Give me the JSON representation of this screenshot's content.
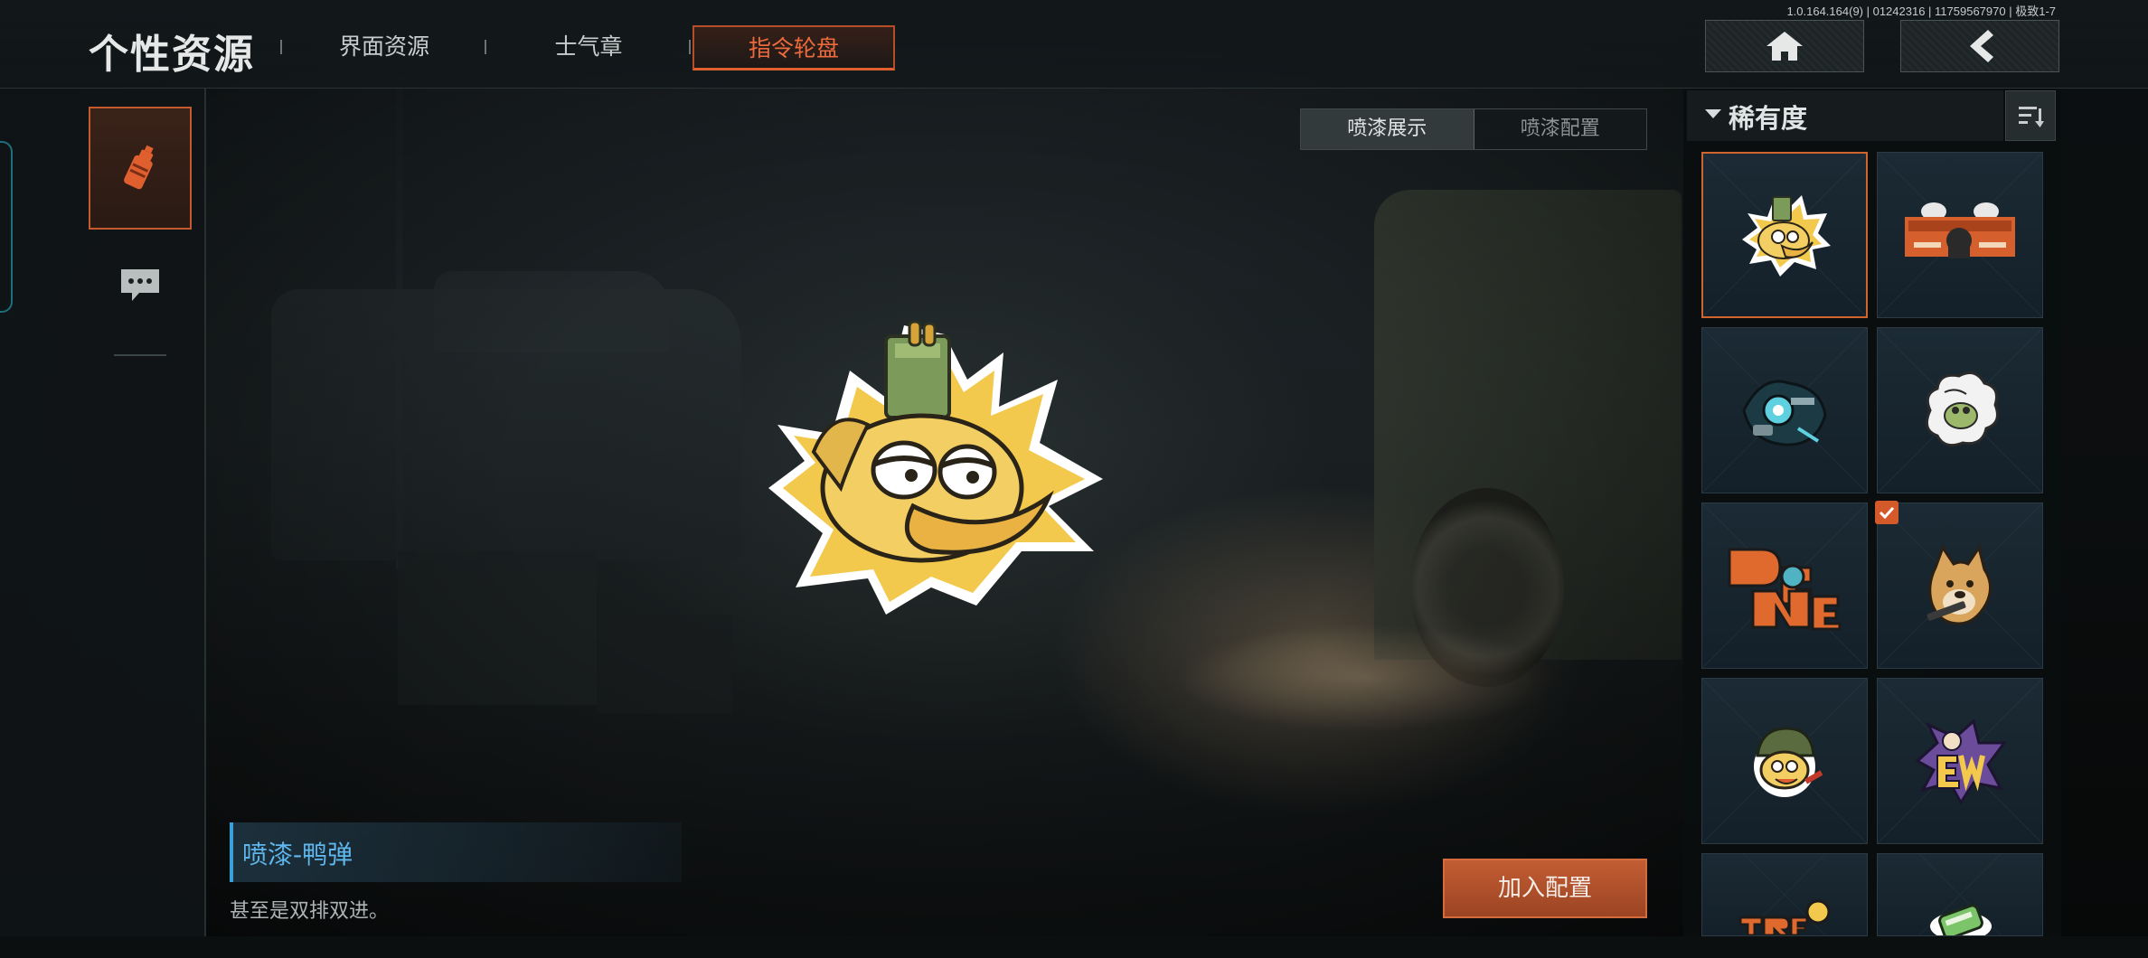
{
  "version": "1.0.164.164(9) | 01242316 | 11759567970 | 极致1-7",
  "header": {
    "title": "个性资源",
    "tabs": [
      {
        "label": "界面资源"
      },
      {
        "label": "士气章"
      },
      {
        "label": "指令轮盘"
      }
    ],
    "home_icon": "home-icon",
    "back_icon": "back-chevron-icon"
  },
  "left_rail": {
    "items": [
      {
        "icon": "spray-can-icon",
        "active": true
      },
      {
        "icon": "chat-bubble-icon",
        "active": false
      }
    ]
  },
  "sub_tabs": [
    {
      "label": "喷漆展示"
    },
    {
      "label": "喷漆配置"
    }
  ],
  "selected_item": {
    "name": "喷漆-鸭弹",
    "description": "甚至是双排双进。"
  },
  "add_button_label": "加入配置",
  "right_panel": {
    "sort_title": "稀有度",
    "items": [
      {
        "icon": "duck-ammo-spray-icon",
        "selected": true,
        "checked": false
      },
      {
        "icon": "soldier-banner-spray-icon",
        "selected": false,
        "checked": false
      },
      {
        "icon": "blue-robot-spray-icon",
        "selected": false,
        "checked": false
      },
      {
        "icon": "cloud-frog-spray-icon",
        "selected": false,
        "checked": false
      },
      {
        "icon": "dream-graffiti-spray-icon",
        "selected": false,
        "checked": false
      },
      {
        "icon": "doge-spray-icon",
        "selected": false,
        "checked": true
      },
      {
        "icon": "helmet-duck-spray-icon",
        "selected": false,
        "checked": false
      },
      {
        "icon": "ewa-graffiti-spray-icon",
        "selected": false,
        "checked": false
      },
      {
        "icon": "tree-graffiti-spray-icon",
        "selected": false,
        "checked": false
      },
      {
        "icon": "green-can-spray-icon",
        "selected": false,
        "checked": false
      }
    ]
  },
  "colors": {
    "accent": "#e05f2f",
    "info_blue": "#5fb6ec",
    "panel_bg": "#141a1c"
  }
}
